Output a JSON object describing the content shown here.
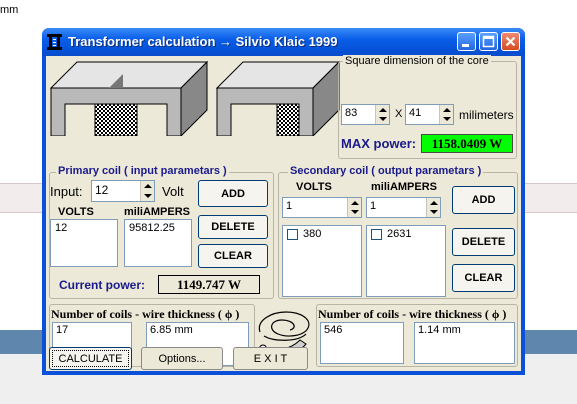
{
  "background": {
    "fragment_text": "mm"
  },
  "window": {
    "title": "Transformer calculation → Silvio Klaic 1999",
    "controls": {
      "minimize": "minimize-icon",
      "maximize": "maximize-icon",
      "close": "close-icon"
    }
  },
  "core": {
    "group_title": "Square dimension of the core",
    "width_value": "83",
    "height_value": "41",
    "times_label": "X",
    "unit_label": "milimeters",
    "max_power_label": "MAX power:",
    "max_power_value": "1158.0409 W"
  },
  "primary": {
    "group_title": "Primary coil ( input parametars )",
    "input_label": "Input:",
    "input_value": "12",
    "volt_label": "Volt",
    "volts_header": "VOLTS",
    "ampers_header": "miliAMPERS",
    "volts_list": [
      "12"
    ],
    "ampers_list": [
      "95812.25"
    ],
    "add_label": "ADD",
    "delete_label": "DELETE",
    "clear_label": "CLEAR",
    "current_power_label": "Current power:",
    "current_power_value": "1149.747 W"
  },
  "secondary": {
    "group_title": "Secondary coil ( output parametars )",
    "volts_header": "VOLTS",
    "ampers_header": "miliAMPERS",
    "volts_input": "1",
    "ampers_input": "1",
    "volts_list": [
      "380"
    ],
    "ampers_list": [
      "2631"
    ],
    "add_label": "ADD",
    "delete_label": "DELETE",
    "clear_label": "CLEAR"
  },
  "coils_primary": {
    "title": "Number of coils - wire thickness (",
    "title_symbol": "ϕ",
    "title_end": ")",
    "coils_value": "17",
    "thickness_value": "6.85 mm"
  },
  "coils_secondary": {
    "title": "Number of coils - wire thickness (",
    "title_symbol": "ϕ",
    "title_end": ")",
    "coils_value": "546",
    "thickness_value": "1.14 mm"
  },
  "actions": {
    "calculate_label": "CALCULATE",
    "options_label": "Options...",
    "exit_label": "E X I T"
  },
  "colors": {
    "titlebar": "#0a5ee8",
    "max_power_bg": "#00ff00",
    "label_blue": "#1a1a8c",
    "face": "#ece9d8"
  }
}
